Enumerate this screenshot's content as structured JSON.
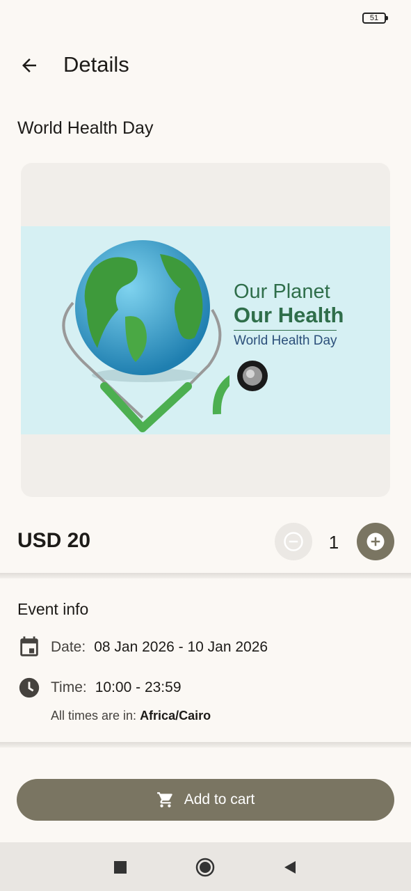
{
  "status_bar": {
    "battery": "51"
  },
  "app_bar": {
    "title": "Details",
    "back_icon": "arrow-left-icon"
  },
  "event": {
    "title": "World Health Day",
    "banner": {
      "line1": "Our Planet",
      "line2": "Our Health",
      "line3": "World Health Day"
    }
  },
  "purchase": {
    "price": "USD 20",
    "quantity": "1",
    "minus_icon": "minus-circle-icon",
    "plus_icon": "plus-circle-icon"
  },
  "event_info": {
    "heading": "Event info",
    "date_label": "Date:",
    "date_value": "08 Jan 2026 - 10 Jan 2026",
    "time_label": "Time:",
    "time_value": "10:00 - 23:59",
    "tz_prefix": "All times are in:",
    "tz_value": "Africa/Cairo"
  },
  "cart": {
    "label": "Add to cart",
    "icon": "cart-icon"
  },
  "nav": {
    "recents_icon": "square-icon",
    "home_icon": "circle-icon",
    "back_icon": "triangle-back-icon"
  },
  "colors": {
    "accent": "#7a7562",
    "background": "#fbf8f4",
    "disabled": "#ebe8e4"
  }
}
